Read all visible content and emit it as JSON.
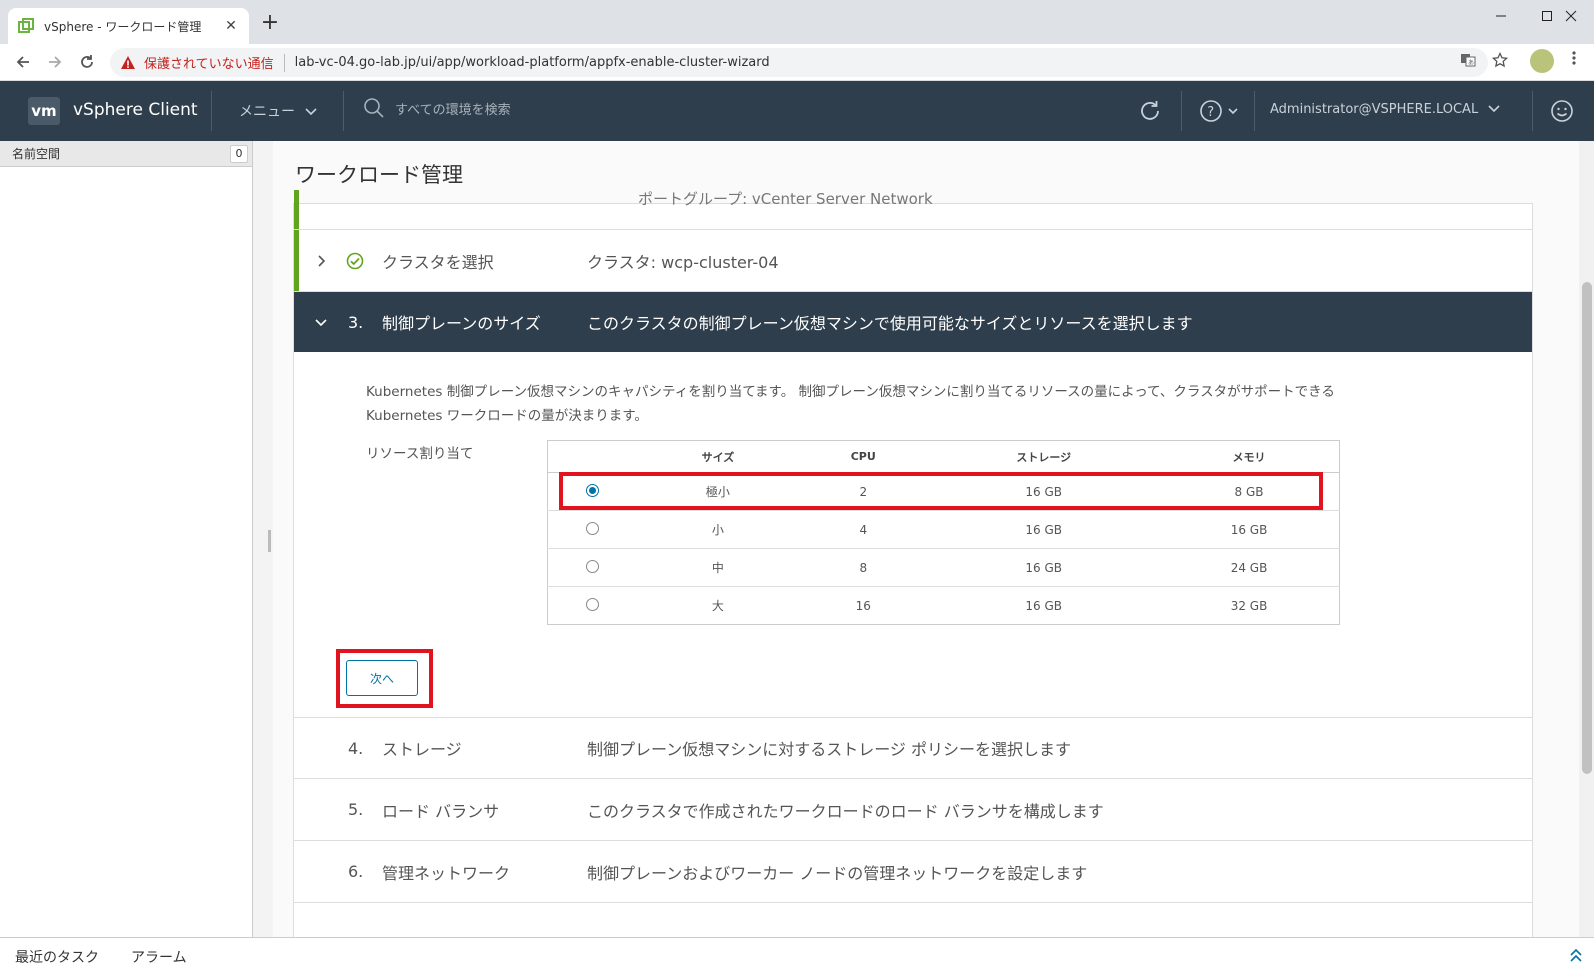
{
  "browser": {
    "tab_title": "vSphere - ワークロード管理",
    "tab_close": "✕",
    "new_tab": "+",
    "security_warning": "保護されていない通信",
    "url": "lab-vc-04.go-lab.jp/ui/app/workload-platform/appfx-enable-cluster-wizard"
  },
  "header": {
    "logo": "vm",
    "app_name": "vSphere Client",
    "menu_label": "メニュー",
    "search_placeholder": "すべての環境を検索",
    "user": "Administrator@VSPHERE.LOCAL"
  },
  "sidebar": {
    "title": "名前空間",
    "count": "0"
  },
  "page": {
    "title": "ワークロード管理"
  },
  "wizard": {
    "cut_off_text": "ポートグループ: vCenter Server Network",
    "steps": [
      {
        "number": "",
        "name": "クラスタを選択",
        "desc": "クラスタ: wcp-cluster-04"
      },
      {
        "number": "3.",
        "name": "制御プレーンのサイズ",
        "desc": "このクラスタの制御プレーン仮想マシンで使用可能なサイズとリソースを選択します"
      },
      {
        "number": "4.",
        "name": "ストレージ",
        "desc": "制御プレーン仮想マシンに対するストレージ ポリシーを選択します"
      },
      {
        "number": "5.",
        "name": "ロード バランサ",
        "desc": "このクラスタで作成されたワークロードのロード バランサを構成します"
      },
      {
        "number": "6.",
        "name": "管理ネットワーク",
        "desc": "制御プレーンおよびワーカー ノードの管理ネットワークを設定します"
      }
    ],
    "description_line1": "Kubernetes 制御プレーン仮想マシンのキャパシティを割り当てます。 制御プレーン仮想マシンに割り当てるリソースの量によって、クラスタがサポートできる",
    "description_line2": "Kubernetes ワークロードの量が決まります。",
    "resource_label": "リソース割り当て",
    "table": {
      "headers": {
        "size": "サイズ",
        "cpu": "CPU",
        "storage": "ストレージ",
        "memory": "メモリ"
      },
      "rows": [
        {
          "size": "極小",
          "cpu": "2",
          "storage": "16 GB",
          "memory": "8 GB",
          "selected": true
        },
        {
          "size": "小",
          "cpu": "4",
          "storage": "16 GB",
          "memory": "16 GB",
          "selected": false
        },
        {
          "size": "中",
          "cpu": "8",
          "storage": "16 GB",
          "memory": "24 GB",
          "selected": false
        },
        {
          "size": "大",
          "cpu": "16",
          "storage": "16 GB",
          "memory": "32 GB",
          "selected": false
        }
      ]
    },
    "next_button": "次へ"
  },
  "bottom": {
    "recent_tasks": "最近のタスク",
    "alarms": "アラーム"
  },
  "colors": {
    "header_bg": "#2e3e4c",
    "accent_green": "#62a420",
    "primary_blue": "#0072a3",
    "highlight_red": "#e0141e"
  }
}
